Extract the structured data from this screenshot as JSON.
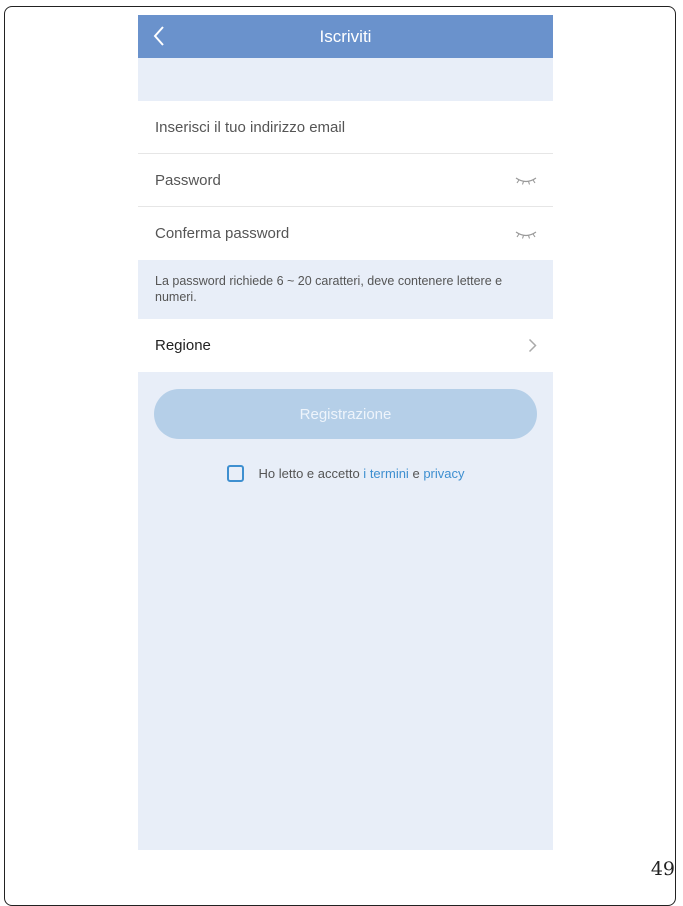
{
  "header": {
    "title": "Iscriviti",
    "back_icon": "chevron-left-icon"
  },
  "form": {
    "email_placeholder": "Inserisci il tuo indirizzo email",
    "password_placeholder": "Password",
    "confirm_placeholder": "Conferma password",
    "eye_icon": "eye-closed-icon"
  },
  "hint": "La password richiede 6 ~ 20 caratteri, deve contenere lettere e numeri.",
  "region": {
    "label": "Regione",
    "chevron_icon": "chevron-right-icon"
  },
  "register_button": "Registrazione",
  "agreement": {
    "prefix": "Ho letto e accetto",
    "i": "i",
    "terms": "termini",
    "and": "e",
    "privacy": "privacy"
  },
  "page_number": "49",
  "colors": {
    "header": "#6a92cc",
    "background": "#e8eef8",
    "button_disabled": "#b5cfe8",
    "link": "#3e8fd0"
  }
}
